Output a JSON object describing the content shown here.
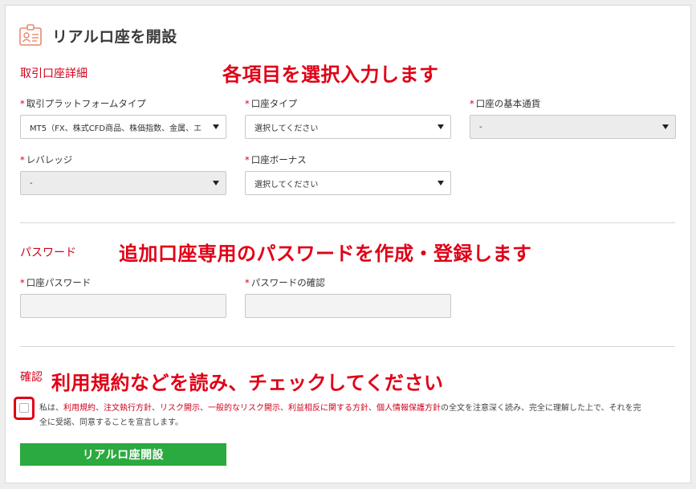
{
  "header": {
    "title": "リアルロ座を開設",
    "icon": "id-card-icon"
  },
  "section_account": {
    "label": "取引口座詳細",
    "callout": "各項目を選択入力します",
    "platform": {
      "label": "取引プラットフォームタイプ",
      "value": "MT5（FX、株式CFD商品、株価指数、金属、エ"
    },
    "account_type": {
      "label": "口座タイプ",
      "value": "選択してください"
    },
    "base_currency": {
      "label": "口座の基本通貨",
      "value": "-"
    },
    "leverage": {
      "label": "レバレッジ",
      "value": "-"
    },
    "bonus": {
      "label": "口座ボーナス",
      "value": "選択してください"
    }
  },
  "section_password": {
    "label": "パスワード",
    "callout": "追加口座専用のパスワードを作成・登録します",
    "password": {
      "label": "口座パスワード",
      "value": ""
    },
    "password_confirm": {
      "label": "パスワードの確認",
      "value": ""
    }
  },
  "section_confirm": {
    "label": "確認",
    "callout": "利用規約などを読み、チェックしてください",
    "agreement_prefix": "私は、",
    "links": [
      "利用規約",
      "注文執行方針",
      "リスク開示",
      "一般的なリスク開示",
      "利益相反に関する方針",
      "個人情報保護方針"
    ],
    "separator": "、",
    "agreement_middle": "の全文を注意深く読み、完全に理解した上で、それを完",
    "agreement_suffix": "全に受諾、同意することを宣言します。"
  },
  "required_mark": "*",
  "submit": {
    "label": "リアルロ座開設"
  },
  "colors": {
    "accent_red": "#d0021b",
    "callout_red": "#e00016",
    "button_green": "#2aaa3f"
  }
}
